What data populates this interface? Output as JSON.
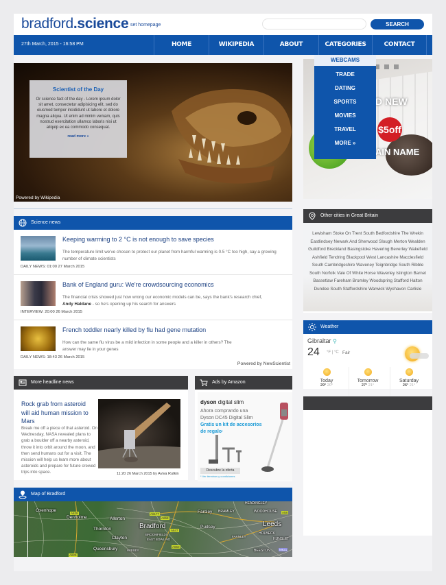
{
  "header": {
    "logo_light": "bradford",
    "logo_bold": ".science",
    "set_homepage": "set homepage",
    "search_placeholder": "",
    "search_button": "SEARCH"
  },
  "navbar": {
    "date": "27th March, 2015 - 16:58 PM",
    "items": [
      "HOME",
      "WIKIPEDIA",
      "ABOUT",
      "CATEGORIES",
      "CONTACT"
    ]
  },
  "categories_dropdown": {
    "items": [
      "WEBCAMS",
      "TRADE",
      "DATING",
      "SPORTS",
      "MOVIES",
      "TRAVEL",
      "MORE »"
    ],
    "active": "WEBCAMS"
  },
  "hero": {
    "title": "Scientist of the Day",
    "body": "Or science fact of the day - Lorem ipsum dolor sit amet, consectetur adipisicing elit, sed do eiusmod tempor incididunt ut labore et dolore magna aliqua. Ut enim ad minim veniam, quis nostrud exercitation ullamco laboris nisi ut aliquip ex ea commodo consequat.",
    "read_more": "read more »",
    "powered_by": "Powered by Wikipedia"
  },
  "top_ad": {
    "line1": "D NEW",
    "badge": "$5off",
    "line2": "AIN NAME"
  },
  "science_news": {
    "title": "Science news",
    "items": [
      {
        "title": "Keeping warming to 2 °C is not enough to save species",
        "desc": "The temperature limit we've chosen to protect our planet from harmful warming is 0.5 °C too high, say a growing number of climate scientists",
        "meta": "DAILY NEWS:  01:00 27 March 2015"
      },
      {
        "title": "Bank of England guru: We're crowdsourcing economics",
        "desc_pre": "The financial crisis showed just how wrong our economic models can be, says the bank's research chief,",
        "desc_bold": "Andy Haldane",
        "desc_post": " - so he's opening up his search for answers",
        "meta": "INTERVIEW:  20:00 26 March 2015"
      },
      {
        "title": "French toddler nearly killed by flu had gene mutation",
        "desc": "How can the same flu virus be a mild infection in some people and a killer in others? The answer may lie in your genes",
        "meta": "DAILY NEWS:  18:43 26 March 2015"
      }
    ],
    "powered_by": "Powered by NewScientist"
  },
  "cities": {
    "title": "Other cities in Great Britain",
    "text": "Lewisham Stoke On Trent South Bedfordshire The Wrekin Eastlindsey Newark And Sherwood Slough Merton Wealden Guildford Breckland Basingstoke Havering Beverley Wakefield Ashfield Tendring Blackpool West Lancashire Macclesfield South Cambridgeshire Waveney Teignbridge South Ribble South Norfolk Vale Of White Horse Waverley Islington Barnet Bassetlaw Fareham Bromley Woodspring Stafford Halton Dundee South Staffordshire Warwick Wychavon Carlisle"
  },
  "weather": {
    "title": "Weather",
    "city": "Gibraltar",
    "temp": "24",
    "units": "°F | °C",
    "condition": "Fair",
    "days": [
      {
        "name": "Today",
        "high": "29°",
        "low": "20°"
      },
      {
        "name": "Tomorrow",
        "high": "27°",
        "low": "21°"
      },
      {
        "name": "Saturday",
        "high": "26°",
        "low": "21°"
      }
    ]
  },
  "more_headlines": {
    "title": "More headline news",
    "headline": "Rock grab from asteroid will aid human mission to Mars",
    "body": "Break me off a piece of that asteroid. On Wednesday, NASA revealed plans to grab a boulder off a nearby asteroid, throw it into orbit around the moon, and then send humans out for a visit. The mission will help us learn more about asteroids and prepare for future crewed trips into space.",
    "meta": "11:20 26 March 2015 by Aviva Rutkin"
  },
  "amazon_ads": {
    "title": "Ads by Amazon",
    "brand": "dyson",
    "product": "digital slim",
    "line1": "Ahora comprando una Dyson DC45 Digital Slim",
    "line2": "Gratis un kit de accesorios de regalo·",
    "button": "Descubre la oferta",
    "terms": "* Ver términos y condiciones"
  },
  "map": {
    "title": "Map of Bradford",
    "labels": [
      "Oxenhope",
      "Denholme",
      "Allerton",
      "Thornton",
      "Clayton",
      "Queensbury",
      "Bradford",
      "BROOMFIELDS",
      "EAST BOWLING",
      "WIBSEY",
      "Farsley",
      "BRAMLEY",
      "Pudsey",
      "FARNLEY",
      "HEADINGLEY",
      "WOODHOUSE",
      "Leeds",
      "HOLBECK",
      "HUNSLET",
      "BEESTON"
    ],
    "roads": [
      "A629",
      "A6177",
      "A658",
      "A647",
      "A650",
      "A58",
      "M621",
      "A629"
    ]
  }
}
